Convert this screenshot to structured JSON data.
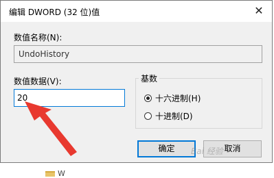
{
  "window": {
    "title": "编辑 DWORD (32 位)值",
    "close_glyph": "✕"
  },
  "value_name": {
    "label": "数值名称(N):",
    "value": "UndoHistory"
  },
  "value_data": {
    "label": "数值数据(V):",
    "value": "20"
  },
  "base": {
    "group_title": "基数",
    "options": [
      {
        "label": "十六进制(H)",
        "checked": true
      },
      {
        "label": "十进制(D)",
        "checked": false
      }
    ]
  },
  "buttons": {
    "ok": "确定",
    "cancel": "取消"
  },
  "background": {
    "partial_text": "W"
  },
  "watermark": "Bai 经验",
  "colors": {
    "accent": "#0078d7",
    "arrow": "#e8392f"
  },
  "icons": {
    "close": "close-icon",
    "arrow": "red-arrow-annotation",
    "folder": "folder-icon"
  }
}
